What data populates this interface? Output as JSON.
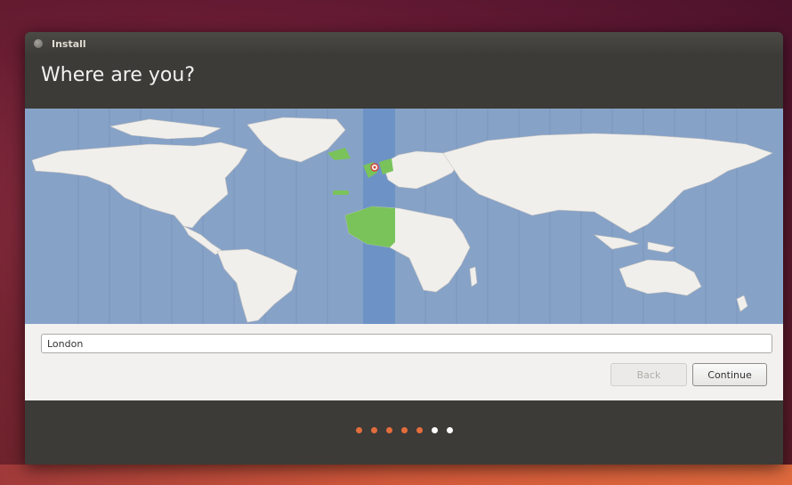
{
  "window": {
    "title": "Install",
    "heading": "Where are you?"
  },
  "timezone": {
    "city_value": "London",
    "selected_city_marker": "red-pin-icon",
    "highlight_color": "#6d93c6",
    "selected_region_color": "#7ac35a",
    "ocean_color": "#87a2c7",
    "land_color": "#f1efec"
  },
  "buttons": {
    "back_label": "Back",
    "continue_label": "Continue",
    "back_enabled": false
  },
  "progress": {
    "total_steps": 7,
    "completed_steps": 5,
    "active_color": "#e36d3c",
    "inactive_color": "#ffffff"
  }
}
